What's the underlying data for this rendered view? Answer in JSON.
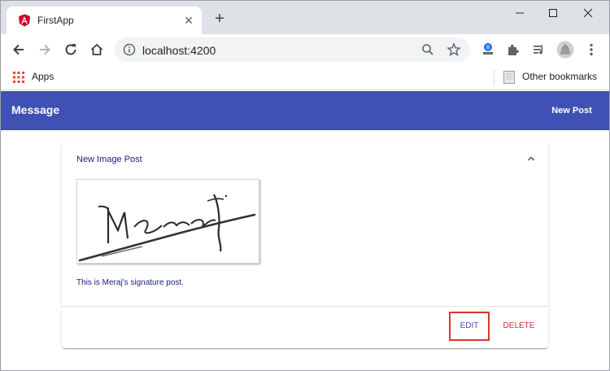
{
  "browser": {
    "tab_title": "FirstApp",
    "tab_close": "✕",
    "new_tab": "+",
    "url": "localhost:4200",
    "bookmarks": {
      "apps_label": "Apps",
      "other_label": "Other bookmarks"
    }
  },
  "app": {
    "title": "Message",
    "new_post_label": "New Post"
  },
  "post": {
    "title": "New Image Post",
    "content": "This is Meraj's signature post.",
    "edit_label": "EDIT",
    "delete_label": "DELETE"
  },
  "colors": {
    "header": "#3f51b5",
    "primary_text": "#1a237e",
    "warn": "#d32f2f",
    "highlight_box": "#d8382c",
    "tab_strip": "#dee1e6"
  },
  "icons": [
    "angular-icon",
    "close-icon",
    "plus-icon",
    "minimize-icon",
    "maximize-icon",
    "window-close-icon",
    "back-arrow-icon",
    "forward-arrow-icon",
    "reload-icon",
    "home-icon",
    "info-icon",
    "zoom-icon",
    "star-icon",
    "extension-account-icon",
    "puzzle-icon",
    "media-queue-icon",
    "profile-avatar-icon",
    "menu-dots-icon",
    "apps-grid-icon",
    "folder-icon",
    "chevron-up-icon"
  ]
}
